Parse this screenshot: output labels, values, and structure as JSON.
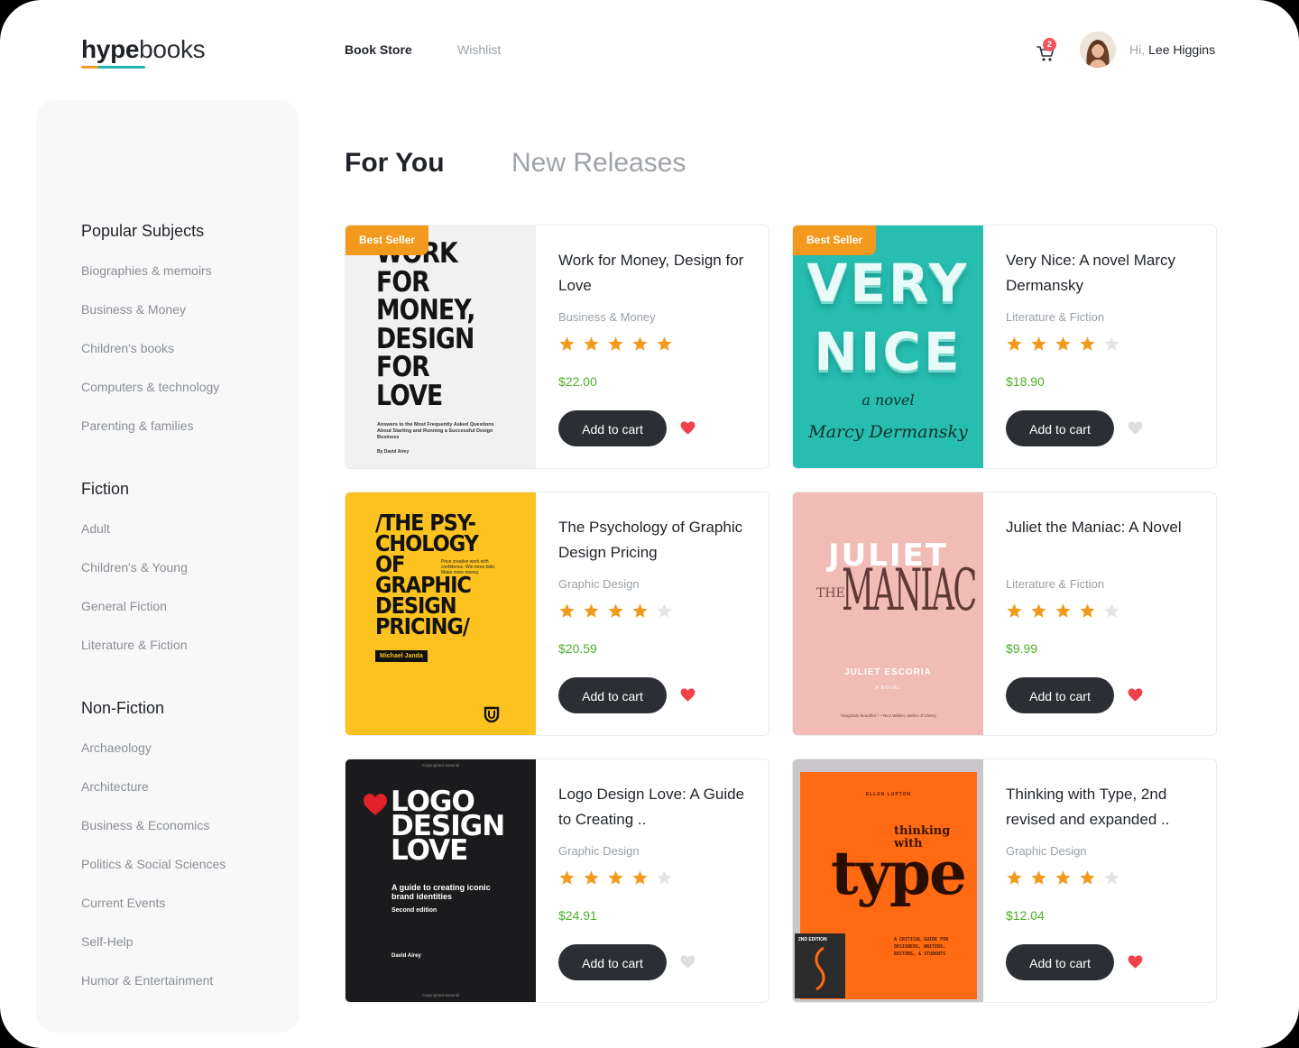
{
  "brand": {
    "bold": "hype",
    "light": "books"
  },
  "nav": {
    "store": "Book Store",
    "wishlist": "Wishlist"
  },
  "cart": {
    "count": "2"
  },
  "user": {
    "greeting": "Hi,",
    "name": "Lee Higgins"
  },
  "sidebar": {
    "popular": {
      "heading": "Popular Subjects",
      "items": [
        "Biographies & memoirs",
        "Business & Money",
        "Children's books",
        "Computers & technology",
        "Parenting & families"
      ]
    },
    "fiction": {
      "heading": "Fiction",
      "items": [
        "Adult",
        "Children's & Young",
        "General Fiction",
        "Literature & Fiction"
      ]
    },
    "nonfiction": {
      "heading": "Non-Fiction",
      "items": [
        "Archaeology",
        "Architecture",
        "Business & Economics",
        "Politics & Social Sciences",
        "Current Events",
        "Self-Help",
        "Humor & Entertainment"
      ]
    }
  },
  "tabs": {
    "for_you": "For You",
    "new_releases": "New Releases"
  },
  "books": [
    {
      "title": "Work for Money, Design for Love",
      "category": "Business & Money",
      "rating": 5,
      "price": "$22.00",
      "badge": "Best Seller",
      "button": "Add to cart",
      "wishlisted": true,
      "cover": {
        "lines": [
          "WORK",
          "FOR",
          "MONEY,",
          "DESIGN",
          "FOR",
          "LOVE"
        ],
        "subtitle": "Answers to the Most Frequently Asked Questions About Starting and Running a Successful Design Business",
        "author": "By David Airey"
      }
    },
    {
      "title": "Very Nice: A novel Marcy Dermansky",
      "category": "Literature & Fiction",
      "rating": 4,
      "price": "$18.90",
      "badge": "Best Seller",
      "button": "Add to cart",
      "wishlisted": false,
      "cover": {
        "lines": [
          "VERY",
          "NICE"
        ],
        "subtitle": "a novel",
        "author": "Marcy Dermansky"
      }
    },
    {
      "title": "The Psychology of Graphic Design Pricing",
      "category": "Graphic Design",
      "rating": 4,
      "price": "$20.59",
      "badge": "",
      "button": "Add to cart",
      "wishlisted": true,
      "cover": {
        "lines": [
          "/THE PSY-",
          "CHOLOGY",
          "OF",
          "GRAPHIC",
          "DESIGN",
          "PRICING/"
        ],
        "subtitle": "Price creative work with confidence. Win more bids. Make more money.",
        "author": "Michael Janda"
      }
    },
    {
      "title": "Juliet the Maniac: A Novel",
      "category": "Literature & Fiction",
      "rating": 4,
      "price": "$9.99",
      "badge": "",
      "button": "Add to cart",
      "wishlisted": true,
      "cover": {
        "lines": [
          "JULIET",
          "THE",
          "MANIAC"
        ],
        "subtitle": "A NOVEL",
        "author": "JULIET ESCORIA",
        "quote": "“Singularly beautiful.” —Nico Walker, author of Cherry"
      }
    },
    {
      "title": "Logo Design Love: A Guide to Creating ..",
      "category": "Graphic Design",
      "rating": 4,
      "price": "$24.91",
      "badge": "",
      "button": "Add to cart",
      "wishlisted": false,
      "cover": {
        "lines": [
          "LOGO",
          "DESIGN",
          "LOVE"
        ],
        "subtitle": "A guide to creating iconic brand identities",
        "edition": "Second edition",
        "author": "David Airey",
        "mark": "Copyrighted Material"
      }
    },
    {
      "title": "Thinking with Type, 2nd revised and expanded ..",
      "category": "Graphic Design",
      "rating": 4,
      "price": "$12.04",
      "badge": "",
      "button": "Add to cart",
      "wishlisted": true,
      "cover": {
        "lines": [
          "thinking",
          "with",
          "type"
        ],
        "subtitle": "A CRITICAL GUIDE FOR DESIGNERS, WRITERS, EDITORS, & STUDENTS",
        "author": "ELLEN LUPTON",
        "edition": "2ND EDITION"
      }
    }
  ],
  "colors": {
    "accent": "#f39a1e",
    "teal": "#22b6ae",
    "price": "#4caf28",
    "heart_on": "#f0424a",
    "heart_off": "#dedede",
    "star_on": "#f39a1e",
    "star_off": "#e4e4e4"
  }
}
